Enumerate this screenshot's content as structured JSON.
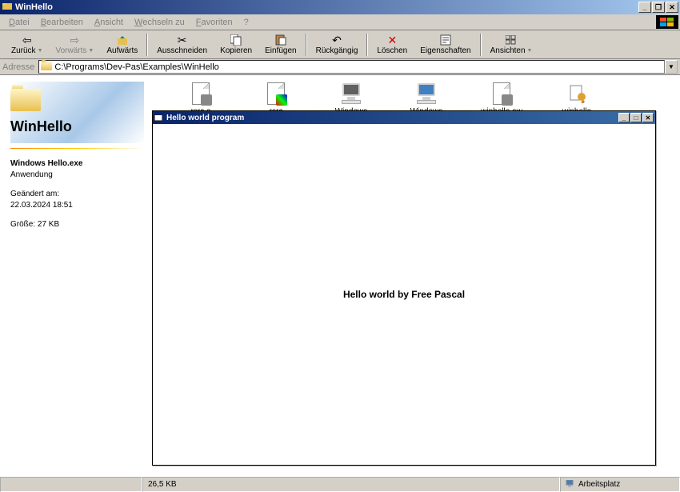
{
  "window": {
    "title": "WinHello"
  },
  "menu": {
    "items": [
      "Datei",
      "Bearbeiten",
      "Ansicht",
      "Wechseln zu",
      "Favoriten",
      "?"
    ]
  },
  "toolbar": {
    "back": "Zurück",
    "forward": "Vorwärts",
    "up": "Aufwärts",
    "cut": "Ausschneiden",
    "copy": "Kopieren",
    "paste": "Einfügen",
    "undo": "Rückgängig",
    "delete": "Löschen",
    "properties": "Eigenschaften",
    "views": "Ansichten"
  },
  "address": {
    "label": "Adresse",
    "path": "C:\\Programs\\Dev-Pas\\Examples\\WinHello"
  },
  "leftpane": {
    "folder_title": "WinHello",
    "file_name": "Windows Hello.exe",
    "file_type": "Anwendung",
    "modified_label": "Geändert am:",
    "modified_value": "22.03.2024 18:51",
    "size_label": "Größe:",
    "size_value": "27 KB"
  },
  "files": [
    {
      "name": "rsrc.o",
      "icon": "doc"
    },
    {
      "name": "rsrc",
      "icon": "rsrc"
    },
    {
      "name": "Windows Hello",
      "icon": "exe-gray"
    },
    {
      "name": "Windows Hello",
      "icon": "exe"
    },
    {
      "name": "winhello.ow",
      "icon": "doc"
    },
    {
      "name": "winhello",
      "icon": "tool"
    }
  ],
  "innerwin": {
    "title": "Hello world program",
    "content": "Hello world by Free Pascal"
  },
  "statusbar": {
    "size": "26,5 KB",
    "location": "Arbeitsplatz"
  }
}
